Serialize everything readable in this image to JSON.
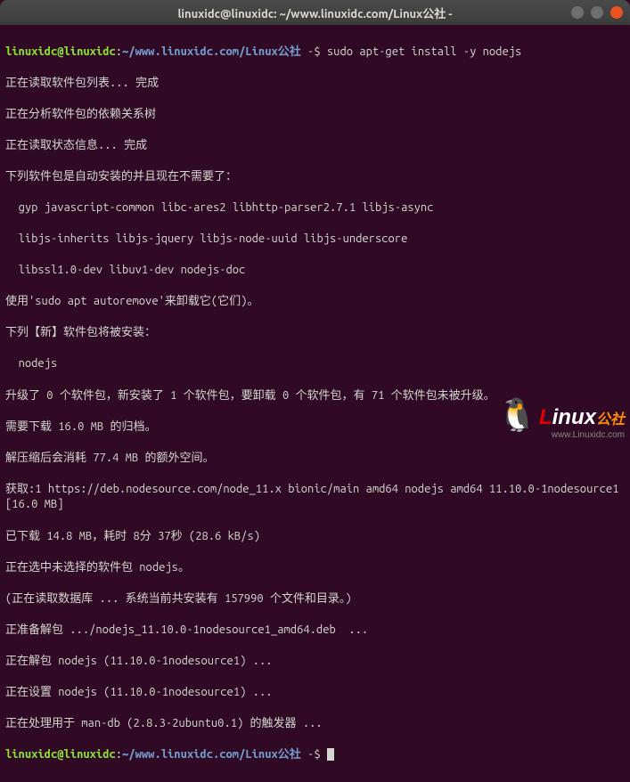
{
  "titlebar": {
    "title": "linuxidc@linuxidc: ~/www.linuxidc.com/Linux公社 -"
  },
  "prompt1": {
    "user": "linuxidc@linuxidc",
    "sep": ":",
    "tilde": "~",
    "path": "/www.linuxidc.com/Linux公社",
    "marker": " -$ ",
    "command": "sudo apt-get install -y nodejs"
  },
  "output": {
    "l1": "正在读取软件包列表... 完成",
    "l2": "正在分析软件包的依赖关系树",
    "l3": "正在读取状态信息... 完成",
    "l4": "下列软件包是自动安装的并且现在不需要了：",
    "l5": "  gyp javascript-common libc-ares2 libhttp-parser2.7.1 libjs-async",
    "l6": "  libjs-inherits libjs-jquery libjs-node-uuid libjs-underscore",
    "l7": "  libssl1.0-dev libuv1-dev nodejs-doc",
    "l8": "使用'sudo apt autoremove'来卸载它(它们)。",
    "l9": "下列【新】软件包将被安装：",
    "l10": "  nodejs",
    "l11": "升级了 0 个软件包，新安装了 1 个软件包，要卸载 0 个软件包，有 71 个软件包未被升级。",
    "l12": "需要下载 16.0 MB 的归档。",
    "l13": "解压缩后会消耗 77.4 MB 的额外空间。",
    "l14": "获取:1 https://deb.nodesource.com/node_11.x bionic/main amd64 nodejs amd64 11.10.0-1nodesource1 [16.0 MB]",
    "l15": "已下载 14.8 MB，耗时 8分 37秒 (28.6 kB/s)",
    "l16": "正在选中未选择的软件包 nodejs。",
    "l17": "(正在读取数据库 ... 系统当前共安装有 157990 个文件和目录。)",
    "l18": "正准备解包 .../nodejs_11.10.0-1nodesource1_amd64.deb  ...",
    "l19": "正在解包 nodejs (11.10.0-1nodesource1) ...",
    "l20": "正在设置 nodejs (11.10.0-1nodesource1) ...",
    "l21": "正在处理用于 man-db (2.8.3-2ubuntu0.1) 的触发器 ..."
  },
  "prompt2": {
    "user": "linuxidc@linuxidc",
    "sep": ":",
    "tilde": "~",
    "path": "/www.linuxidc.com/Linux公社",
    "marker": " -$ "
  },
  "watermark": {
    "brand_l": "L",
    "brand_inux": "inux",
    "brand_cn": "公社",
    "url": "www.Linuxidc.com"
  }
}
